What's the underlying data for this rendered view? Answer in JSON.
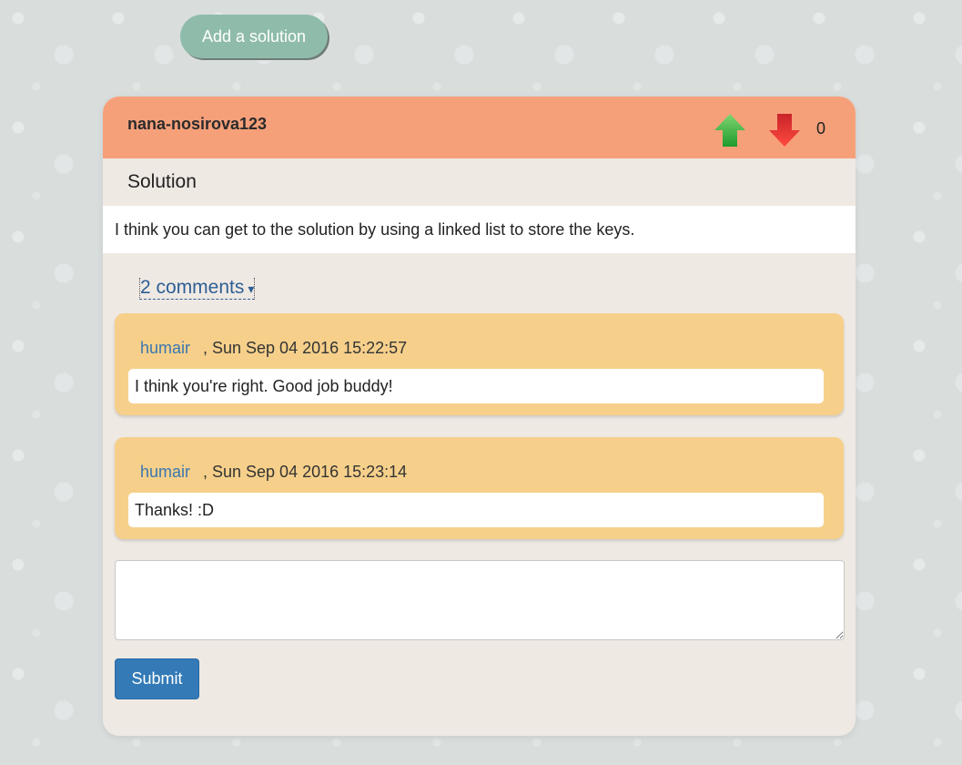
{
  "toolbar": {
    "add_solution_label": "Add a solution"
  },
  "solution": {
    "author": "nana-nosirova123",
    "vote_count": "0",
    "section_title": "Solution",
    "body": "I think you can get to the solution by using a linked list to store the keys.",
    "upvote_icon": "arrow-up-icon",
    "downvote_icon": "arrow-down-icon"
  },
  "comments": {
    "toggle_label": "2 comments",
    "toggle_caret": "▾",
    "items": [
      {
        "user": "humair",
        "date": ", Sun Sep 04 2016 15:22:57",
        "text": "I think you're right. Good job buddy!"
      },
      {
        "user": "humair",
        "date": ", Sun Sep 04 2016 15:23:14",
        "text": "Thanks! :D"
      }
    ]
  },
  "form": {
    "comment_value": "",
    "submit_label": "Submit"
  },
  "colors": {
    "header": "#f6a07a",
    "card": "#efe9e3",
    "comment": "#f6d08b",
    "accent_button": "#337ab7",
    "add_button": "#8fbcaa",
    "upvote": "#2fae3a",
    "downvote": "#e0302a"
  }
}
